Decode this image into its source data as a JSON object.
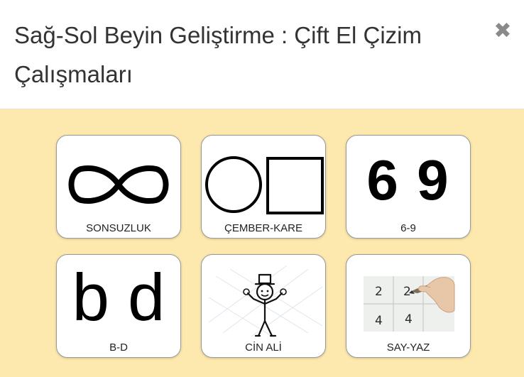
{
  "dialog": {
    "title": "Sağ-Sol Beyin Geliştirme : Çift El Çizim Çalışmaları",
    "close_symbol": "✖"
  },
  "colors": {
    "body_background": "#fde8ae",
    "card_background": "#ffffff",
    "close_icon": "#8a8a8a"
  },
  "cards": [
    {
      "label": "SONSUZLUK",
      "icon": "infinity-icon"
    },
    {
      "label": "ÇEMBER-KARE",
      "icon": "circle-square-icon"
    },
    {
      "label": "6-9",
      "icon": "six-nine-image",
      "glyphs": "6 9"
    },
    {
      "label": "B-D",
      "icon": "b-d-image",
      "glyphs": "b d"
    },
    {
      "label": "CİN ALİ",
      "icon": "stick-figure-icon"
    },
    {
      "label": "SAY-YAZ",
      "icon": "writing-numbers-image",
      "digits": [
        "2",
        "2",
        "4",
        "4"
      ]
    }
  ]
}
